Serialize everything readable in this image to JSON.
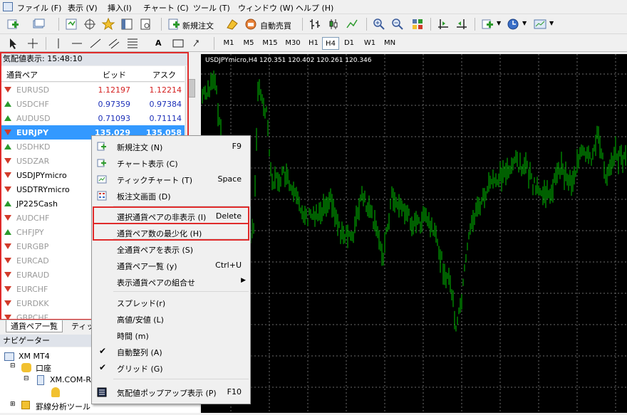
{
  "menubar": {
    "items": [
      "ファイル (F)",
      "表示 (V)",
      "挿入(I)",
      "チャート (C)",
      "ツール (T)",
      "ウィンドウ (W)",
      "ヘルプ (H)"
    ]
  },
  "toolbar": {
    "new_order": "新規注文",
    "auto_trading": "自動売買",
    "timeframes": [
      "M1",
      "M5",
      "M15",
      "M30",
      "H1",
      "H4",
      "D1",
      "W1",
      "MN"
    ],
    "active_timeframe": "H4"
  },
  "market_watch": {
    "title": "気配値表示: 15:48:10",
    "columns": {
      "symbol": "通貨ペア",
      "bid": "ビッド",
      "ask": "アスク"
    },
    "rows": [
      {
        "symbol": "EURUSD",
        "bid": "1.12197",
        "ask": "1.12214",
        "dir": "down",
        "price_color": "#d42020"
      },
      {
        "symbol": "USDCHF",
        "bid": "0.97359",
        "ask": "0.97384",
        "dir": "up",
        "price_color": "#1c2fb8"
      },
      {
        "symbol": "AUDUSD",
        "bid": "0.71093",
        "ask": "0.71114",
        "dir": "up",
        "price_color": "#1c2fb8"
      },
      {
        "symbol": "EURJPY",
        "bid": "135.029",
        "ask": "135.058",
        "dir": "down",
        "selected": true
      },
      {
        "symbol": "USDHKD",
        "dir": "up"
      },
      {
        "symbol": "USDZAR",
        "dir": "down"
      },
      {
        "symbol": "USDJPYmicro",
        "dir": "down",
        "dark": true
      },
      {
        "symbol": "USDTRYmicro",
        "dir": "down",
        "dark": true
      },
      {
        "symbol": "JP225Cash",
        "dir": "up",
        "dark": true
      },
      {
        "symbol": "AUDCHF",
        "dir": "down"
      },
      {
        "symbol": "CHFJPY",
        "dir": "up"
      },
      {
        "symbol": "EURGBP",
        "dir": "down"
      },
      {
        "symbol": "EURCAD",
        "dir": "down"
      },
      {
        "symbol": "EURAUD",
        "dir": "down"
      },
      {
        "symbol": "EURCHF",
        "dir": "down"
      },
      {
        "symbol": "EURDKK",
        "dir": "down"
      },
      {
        "symbol": "GBPCHF",
        "dir": "down"
      }
    ],
    "tabs": [
      "通貨ペア一覧",
      "ティック"
    ]
  },
  "navigator": {
    "title": "ナビゲーター",
    "items": [
      "XM MT4",
      "口座",
      "XM.COM-R",
      "罫線分析ツール"
    ]
  },
  "chart": {
    "label": "USDJPYmicro,H4  120.351 120.402 120.261 120.346"
  },
  "context_menu": {
    "items": [
      {
        "label": "新規注文 (N)",
        "shortcut": "F9",
        "icon": "new-order-icon"
      },
      {
        "label": "チャート表示 (C)",
        "shortcut": "",
        "icon": "chart-window-icon"
      },
      {
        "label": "ティックチャート (T)",
        "shortcut": "Space",
        "icon": "tick-chart-icon"
      },
      {
        "label": "板注文画面 (D)",
        "shortcut": "",
        "icon": "depth-of-market-icon"
      },
      {
        "label": "選択通貨ペアの非表示 (I)",
        "shortcut": "Delete",
        "highlighted": true
      },
      {
        "label": "通貨ペア数の最少化 (H)",
        "shortcut": "",
        "highlighted": true
      },
      {
        "label": "全通貨ペアを表示 (S)",
        "shortcut": ""
      },
      {
        "label": "通貨ペア一覧 (y)",
        "shortcut": "Ctrl+U"
      },
      {
        "label": "表示通貨ペアの組合せ",
        "shortcut": "",
        "submenu": true
      },
      {
        "label": "スプレッド(r)",
        "shortcut": ""
      },
      {
        "label": "高値/安値 (L)",
        "shortcut": ""
      },
      {
        "label": "時間 (m)",
        "shortcut": ""
      },
      {
        "label": "自動整列 (A)",
        "shortcut": "",
        "checked": true
      },
      {
        "label": "グリッド (G)",
        "shortcut": "",
        "checked": true
      },
      {
        "label": "気配値ポップアップ表示 (P)",
        "shortcut": "F10",
        "icon": "popup-prices-icon"
      }
    ]
  },
  "colors": {
    "chart_bg": "#000000",
    "candle": "#00c000",
    "grid": "#6b6b6b",
    "selection": "#3399ff",
    "highlight_border": "#e02b2b"
  }
}
